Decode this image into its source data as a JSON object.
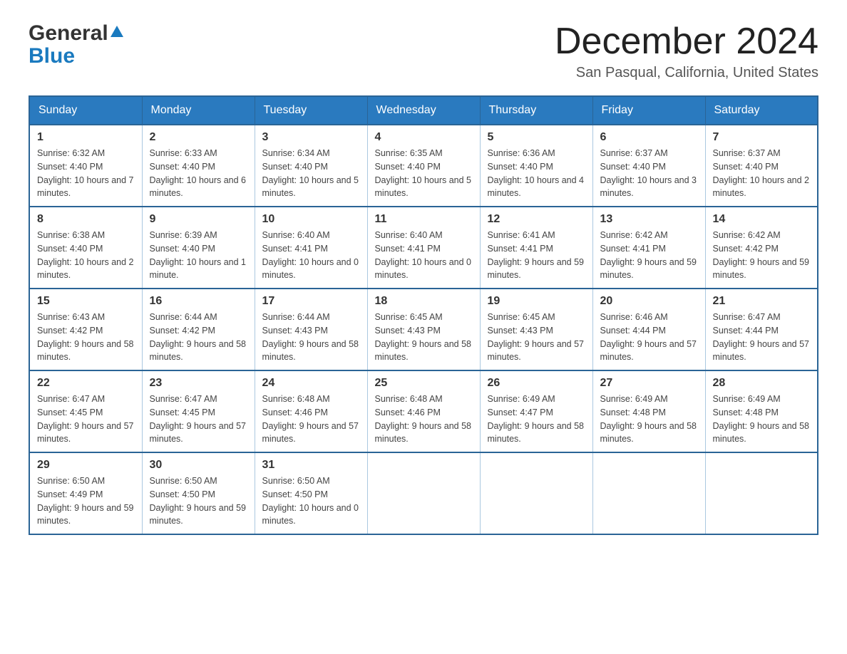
{
  "header": {
    "logo": {
      "general_text": "General",
      "blue_text": "Blue"
    },
    "month_title": "December 2024",
    "location": "San Pasqual, California, United States"
  },
  "days_of_week": [
    "Sunday",
    "Monday",
    "Tuesday",
    "Wednesday",
    "Thursday",
    "Friday",
    "Saturday"
  ],
  "weeks": [
    [
      {
        "day": "1",
        "sunrise": "6:32 AM",
        "sunset": "4:40 PM",
        "daylight": "10 hours and 7 minutes."
      },
      {
        "day": "2",
        "sunrise": "6:33 AM",
        "sunset": "4:40 PM",
        "daylight": "10 hours and 6 minutes."
      },
      {
        "day": "3",
        "sunrise": "6:34 AM",
        "sunset": "4:40 PM",
        "daylight": "10 hours and 5 minutes."
      },
      {
        "day": "4",
        "sunrise": "6:35 AM",
        "sunset": "4:40 PM",
        "daylight": "10 hours and 5 minutes."
      },
      {
        "day": "5",
        "sunrise": "6:36 AM",
        "sunset": "4:40 PM",
        "daylight": "10 hours and 4 minutes."
      },
      {
        "day": "6",
        "sunrise": "6:37 AM",
        "sunset": "4:40 PM",
        "daylight": "10 hours and 3 minutes."
      },
      {
        "day": "7",
        "sunrise": "6:37 AM",
        "sunset": "4:40 PM",
        "daylight": "10 hours and 2 minutes."
      }
    ],
    [
      {
        "day": "8",
        "sunrise": "6:38 AM",
        "sunset": "4:40 PM",
        "daylight": "10 hours and 2 minutes."
      },
      {
        "day": "9",
        "sunrise": "6:39 AM",
        "sunset": "4:40 PM",
        "daylight": "10 hours and 1 minute."
      },
      {
        "day": "10",
        "sunrise": "6:40 AM",
        "sunset": "4:41 PM",
        "daylight": "10 hours and 0 minutes."
      },
      {
        "day": "11",
        "sunrise": "6:40 AM",
        "sunset": "4:41 PM",
        "daylight": "10 hours and 0 minutes."
      },
      {
        "day": "12",
        "sunrise": "6:41 AM",
        "sunset": "4:41 PM",
        "daylight": "9 hours and 59 minutes."
      },
      {
        "day": "13",
        "sunrise": "6:42 AM",
        "sunset": "4:41 PM",
        "daylight": "9 hours and 59 minutes."
      },
      {
        "day": "14",
        "sunrise": "6:42 AM",
        "sunset": "4:42 PM",
        "daylight": "9 hours and 59 minutes."
      }
    ],
    [
      {
        "day": "15",
        "sunrise": "6:43 AM",
        "sunset": "4:42 PM",
        "daylight": "9 hours and 58 minutes."
      },
      {
        "day": "16",
        "sunrise": "6:44 AM",
        "sunset": "4:42 PM",
        "daylight": "9 hours and 58 minutes."
      },
      {
        "day": "17",
        "sunrise": "6:44 AM",
        "sunset": "4:43 PM",
        "daylight": "9 hours and 58 minutes."
      },
      {
        "day": "18",
        "sunrise": "6:45 AM",
        "sunset": "4:43 PM",
        "daylight": "9 hours and 58 minutes."
      },
      {
        "day": "19",
        "sunrise": "6:45 AM",
        "sunset": "4:43 PM",
        "daylight": "9 hours and 57 minutes."
      },
      {
        "day": "20",
        "sunrise": "6:46 AM",
        "sunset": "4:44 PM",
        "daylight": "9 hours and 57 minutes."
      },
      {
        "day": "21",
        "sunrise": "6:47 AM",
        "sunset": "4:44 PM",
        "daylight": "9 hours and 57 minutes."
      }
    ],
    [
      {
        "day": "22",
        "sunrise": "6:47 AM",
        "sunset": "4:45 PM",
        "daylight": "9 hours and 57 minutes."
      },
      {
        "day": "23",
        "sunrise": "6:47 AM",
        "sunset": "4:45 PM",
        "daylight": "9 hours and 57 minutes."
      },
      {
        "day": "24",
        "sunrise": "6:48 AM",
        "sunset": "4:46 PM",
        "daylight": "9 hours and 57 minutes."
      },
      {
        "day": "25",
        "sunrise": "6:48 AM",
        "sunset": "4:46 PM",
        "daylight": "9 hours and 58 minutes."
      },
      {
        "day": "26",
        "sunrise": "6:49 AM",
        "sunset": "4:47 PM",
        "daylight": "9 hours and 58 minutes."
      },
      {
        "day": "27",
        "sunrise": "6:49 AM",
        "sunset": "4:48 PM",
        "daylight": "9 hours and 58 minutes."
      },
      {
        "day": "28",
        "sunrise": "6:49 AM",
        "sunset": "4:48 PM",
        "daylight": "9 hours and 58 minutes."
      }
    ],
    [
      {
        "day": "29",
        "sunrise": "6:50 AM",
        "sunset": "4:49 PM",
        "daylight": "9 hours and 59 minutes."
      },
      {
        "day": "30",
        "sunrise": "6:50 AM",
        "sunset": "4:50 PM",
        "daylight": "9 hours and 59 minutes."
      },
      {
        "day": "31",
        "sunrise": "6:50 AM",
        "sunset": "4:50 PM",
        "daylight": "10 hours and 0 minutes."
      },
      null,
      null,
      null,
      null
    ]
  ]
}
